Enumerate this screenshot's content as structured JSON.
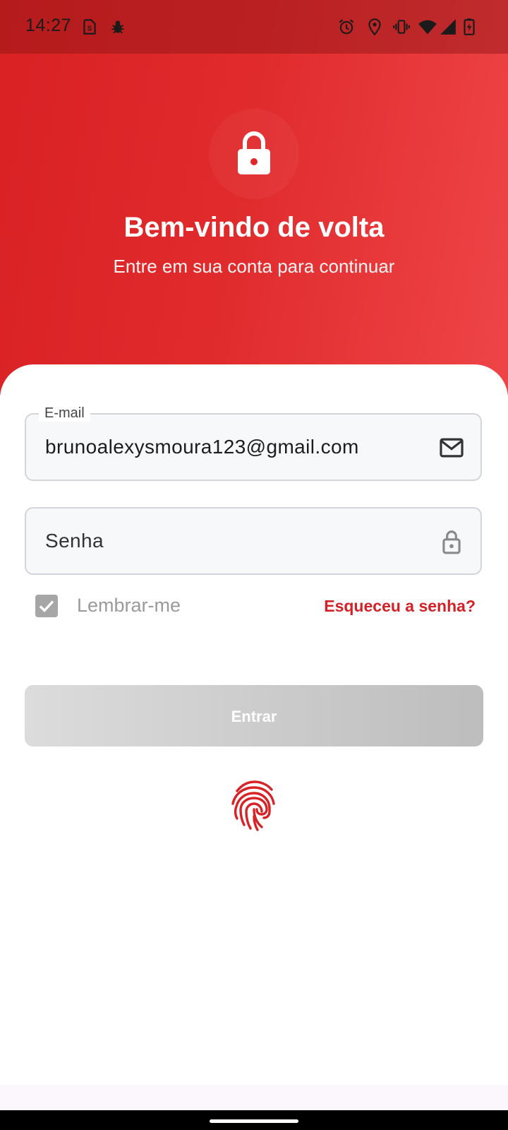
{
  "status_bar": {
    "time": "14:27",
    "left_icons": [
      "sim-card-icon",
      "bug-icon"
    ],
    "right_icons": [
      "alarm-icon",
      "location-icon",
      "vibrate-icon",
      "wifi-icon",
      "signal-icon",
      "battery-charging-icon"
    ]
  },
  "header": {
    "title": "Bem-vindo de volta",
    "subtitle": "Entre em sua conta para continuar",
    "icon": "lock-icon"
  },
  "form": {
    "email": {
      "label": "E-mail",
      "value": "brunoalexysmoura123@gmail.com",
      "icon": "mail-icon"
    },
    "password": {
      "placeholder": "Senha",
      "icon": "lock-icon"
    },
    "remember": {
      "label": "Lembrar-me",
      "checked": true
    },
    "forgot_label": "Esqueceu a senha?",
    "submit_label": "Entrar",
    "biometric_icon": "fingerprint-icon"
  },
  "colors": {
    "brand": "#d92124",
    "brand_light": "#ee4548",
    "link": "#d32227",
    "disabled_button": "#c8c8c8"
  }
}
